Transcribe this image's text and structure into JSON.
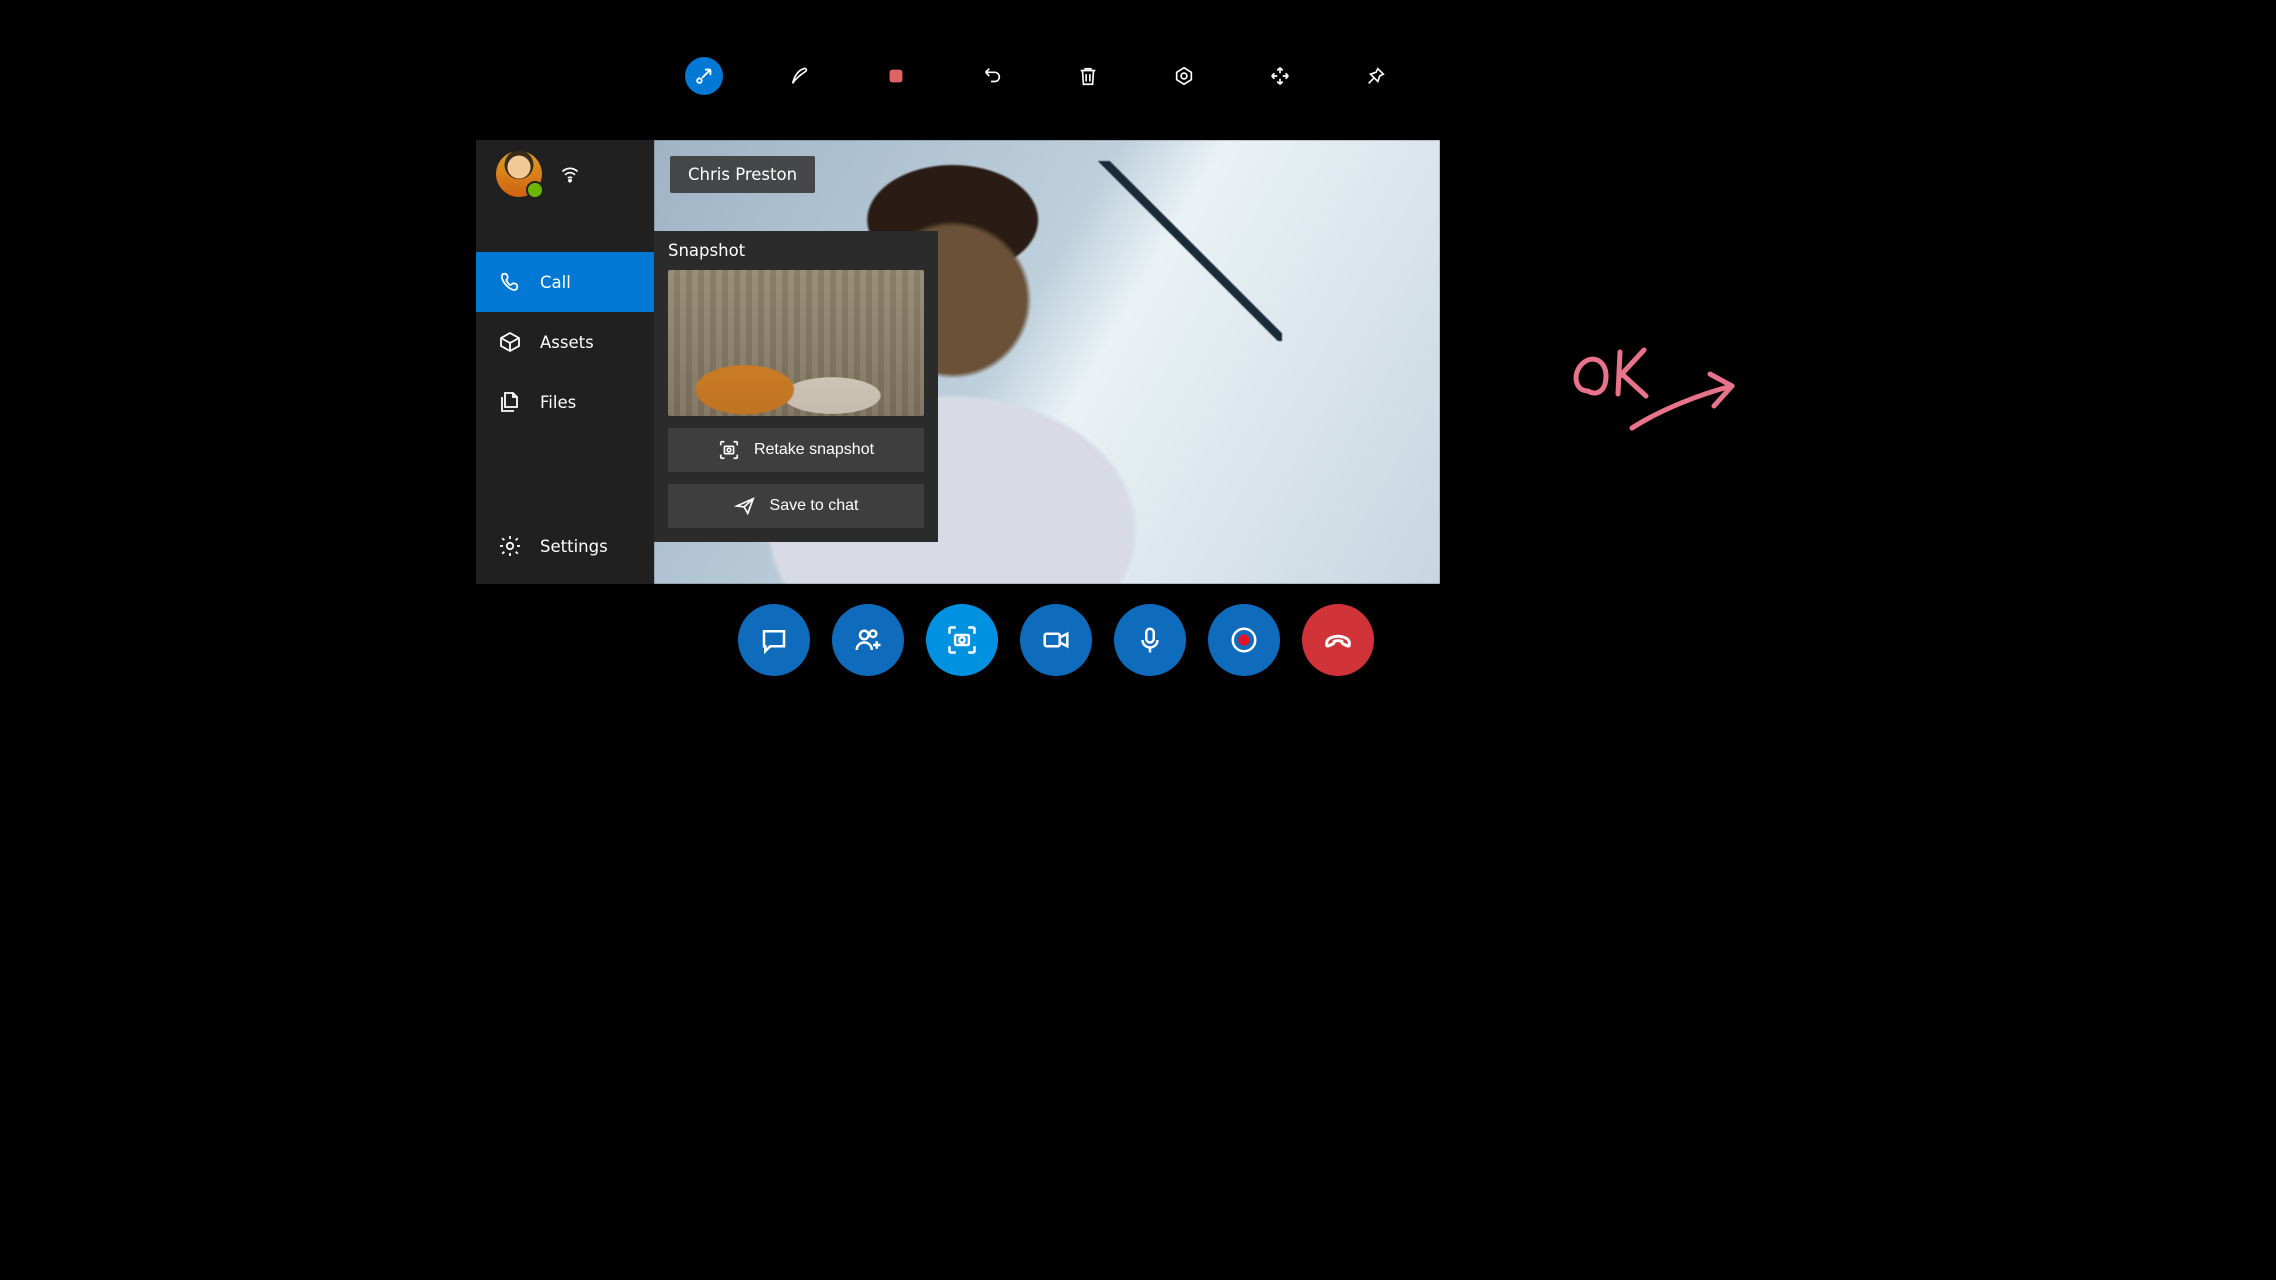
{
  "caller_name": "Chris Preston",
  "sidebar": {
    "items": [
      {
        "label": "Call",
        "active": true
      },
      {
        "label": "Assets",
        "active": false
      },
      {
        "label": "Files",
        "active": false
      }
    ],
    "settings_label": "Settings"
  },
  "popover": {
    "title": "Snapshot",
    "retake_label": "Retake snapshot",
    "save_label": "Save to chat"
  },
  "annotation_text": "OK",
  "colors": {
    "accent": "#0078d4",
    "end_call": "#d13438",
    "record": "#e81123",
    "ink": "#e9738b"
  }
}
